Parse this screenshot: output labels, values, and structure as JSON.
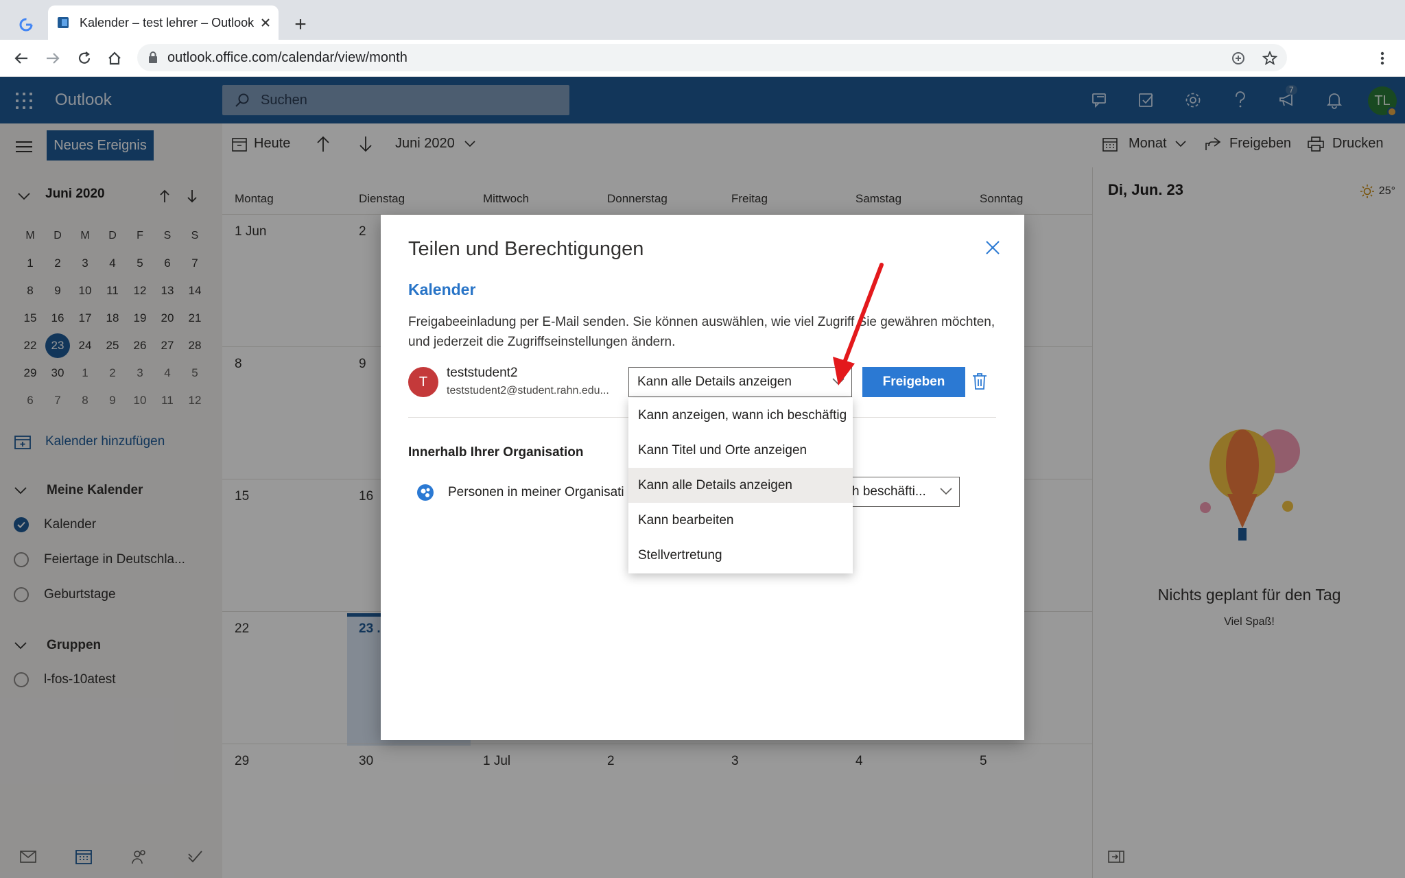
{
  "browser": {
    "tab_title": "Kalender – test lehrer – Outlook",
    "url": "outlook.office.com/calendar/view/month"
  },
  "header": {
    "app_name": "Outlook",
    "search_placeholder": "Suchen",
    "notification_count": "7",
    "avatar_initials": "TL"
  },
  "left": {
    "new_event": "Neues Ereignis",
    "mini_month": "Juni 2020",
    "weekday_heads": [
      "M",
      "D",
      "M",
      "D",
      "F",
      "S",
      "S"
    ],
    "weeks": [
      [
        "1",
        "2",
        "3",
        "4",
        "5",
        "6",
        "7"
      ],
      [
        "8",
        "9",
        "10",
        "11",
        "12",
        "13",
        "14"
      ],
      [
        "15",
        "16",
        "17",
        "18",
        "19",
        "20",
        "21"
      ],
      [
        "22",
        "23",
        "24",
        "25",
        "26",
        "27",
        "28"
      ],
      [
        "29",
        "30",
        "1",
        "2",
        "3",
        "4",
        "5"
      ],
      [
        "6",
        "7",
        "8",
        "9",
        "10",
        "11",
        "12"
      ]
    ],
    "add_calendar": "Kalender hinzufügen",
    "my_calendars": "Meine Kalender",
    "calendar_items": [
      "Kalender",
      "Feiertage in Deutschla...",
      "Geburtstage"
    ],
    "groups": "Gruppen",
    "group_items": [
      "l-fos-10atest"
    ]
  },
  "toolbar": {
    "today": "Heute",
    "month_label": "Juni 2020",
    "view": "Monat",
    "share": "Freigeben",
    "print": "Drucken"
  },
  "calendar": {
    "weekdays": [
      "Montag",
      "Dienstag",
      "Mittwoch",
      "Donnerstag",
      "Freitag",
      "Samstag",
      "Sonntag"
    ],
    "weeks": [
      [
        "1 Jun",
        "2",
        "",
        "",
        "",
        "",
        ""
      ],
      [
        "8",
        "9",
        "",
        "",
        "",
        "",
        ""
      ],
      [
        "15",
        "16",
        "",
        "",
        "",
        "",
        ""
      ],
      [
        "22",
        "23 .",
        "",
        "",
        "",
        "",
        ""
      ],
      [
        "29",
        "30",
        "1 Jul",
        "2",
        "3",
        "4",
        "5"
      ]
    ]
  },
  "right_pane": {
    "date": "Di, Jun. 23",
    "temperature": "25°",
    "empty_title": "Nichts geplant für den Tag",
    "empty_sub": "Viel Spaß!"
  },
  "dialog": {
    "title": "Teilen und Berechtigungen",
    "section": "Kalender",
    "description": "Freigabeeinladung per E-Mail senden. Sie können auswählen, wie viel Zugriff Sie gewähren möchten, und jederzeit die Zugriffseinstellungen ändern.",
    "person_initial": "T",
    "person_name": "teststudent2",
    "person_email": "teststudent2@student.rahn.edu...",
    "permission_selected": "Kann alle Details anzeigen",
    "share_button": "Freigeben",
    "org_header": "Innerhalb Ihrer Organisation",
    "org_label": "Personen in meiner Organisati",
    "org_permission": "h beschäfti..."
  },
  "menu": {
    "options": [
      "Kann anzeigen, wann ich beschäftig",
      "Kann Titel und Orte anzeigen",
      "Kann alle Details anzeigen",
      "Kann bearbeiten",
      "Stellvertretung"
    ],
    "selected_index": 2
  },
  "colors": {
    "brand": "#1f5a96",
    "accent": "#2b79d3",
    "annotation_arrow": "#e3191c"
  }
}
